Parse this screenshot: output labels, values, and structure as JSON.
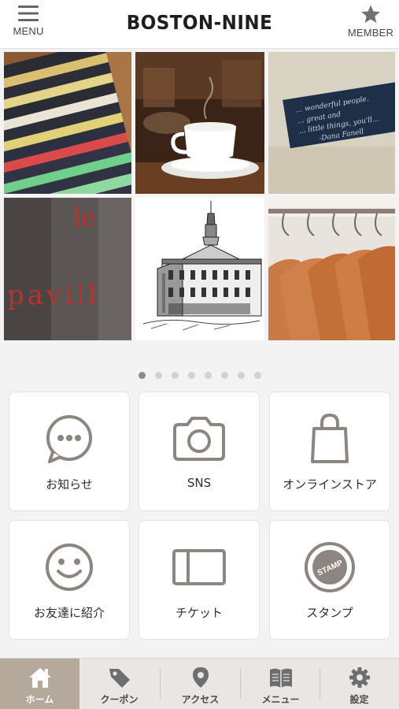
{
  "header": {
    "brand": "BOSTON-NINE",
    "menu_label": "MENU",
    "member_label": "MEMBER"
  },
  "photos": [
    {
      "name": "folded-striped-shirts",
      "text": ""
    },
    {
      "name": "coffee-cup",
      "text": ""
    },
    {
      "name": "embroidered-label",
      "text": "… wonderful people. … great and … little things, you'll… -Dana Fanell"
    },
    {
      "name": "le-pavillon-sign",
      "text": "le pavill"
    },
    {
      "name": "faneuil-hall-drawing",
      "text": ""
    },
    {
      "name": "wooden-hangers",
      "text": ""
    }
  ],
  "carousel": {
    "count": 8,
    "active": 0
  },
  "tiles": [
    {
      "label": "お知らせ",
      "icon": "chat-bubble-icon"
    },
    {
      "label": "SNS",
      "icon": "camera-icon"
    },
    {
      "label": "オンラインストア",
      "icon": "shopping-bag-icon"
    },
    {
      "label": "お友達に紹介",
      "icon": "smiley-icon"
    },
    {
      "label": "チケット",
      "icon": "ticket-icon"
    },
    {
      "label": "スタンプ",
      "icon": "stamp-icon",
      "stamp_text": "STAMP"
    }
  ],
  "tabbar": [
    {
      "label": "ホーム",
      "icon": "home-icon",
      "active": true
    },
    {
      "label": "クーポン",
      "icon": "tag-icon",
      "active": false
    },
    {
      "label": "アクセス",
      "icon": "map-pin-icon",
      "active": false
    },
    {
      "label": "メニュー",
      "icon": "book-icon",
      "active": false
    },
    {
      "label": "設定",
      "icon": "gear-icon",
      "active": false
    }
  ],
  "colors": {
    "tile_icon": "#8c8580",
    "tab_active_bg": "#b5a99c",
    "tab_bar_bg": "#e9e6e4"
  }
}
